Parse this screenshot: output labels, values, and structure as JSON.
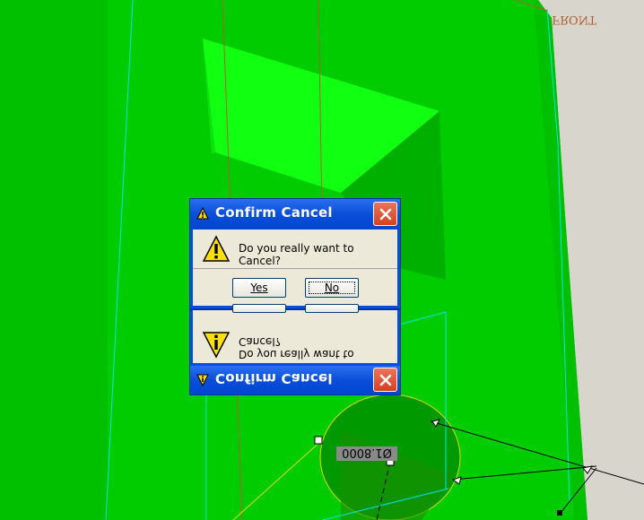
{
  "viewport": {
    "background": "#00c000",
    "datum_label": "FRONT",
    "dimension_label": "Ø1.8000"
  },
  "dialog": {
    "title": "Confirm Cancel",
    "message": "Do you really want to Cancel?",
    "yes_label": "Yes",
    "no_label": "No",
    "title_icon": "warning-icon",
    "message_icon": "warning-icon",
    "close_icon": "close-icon"
  },
  "dialog_mirror": {
    "title": "Confirm Cancel",
    "message": "Do you really want to Cancel?"
  },
  "colors": {
    "titlebar": "#0a4ed8",
    "body": "#ece9d8",
    "close": "#d6401f",
    "model_green": "#00c000",
    "model_bright": "#11ff11",
    "datum_line": "#00e5e5",
    "edge_line": "#b06030"
  }
}
